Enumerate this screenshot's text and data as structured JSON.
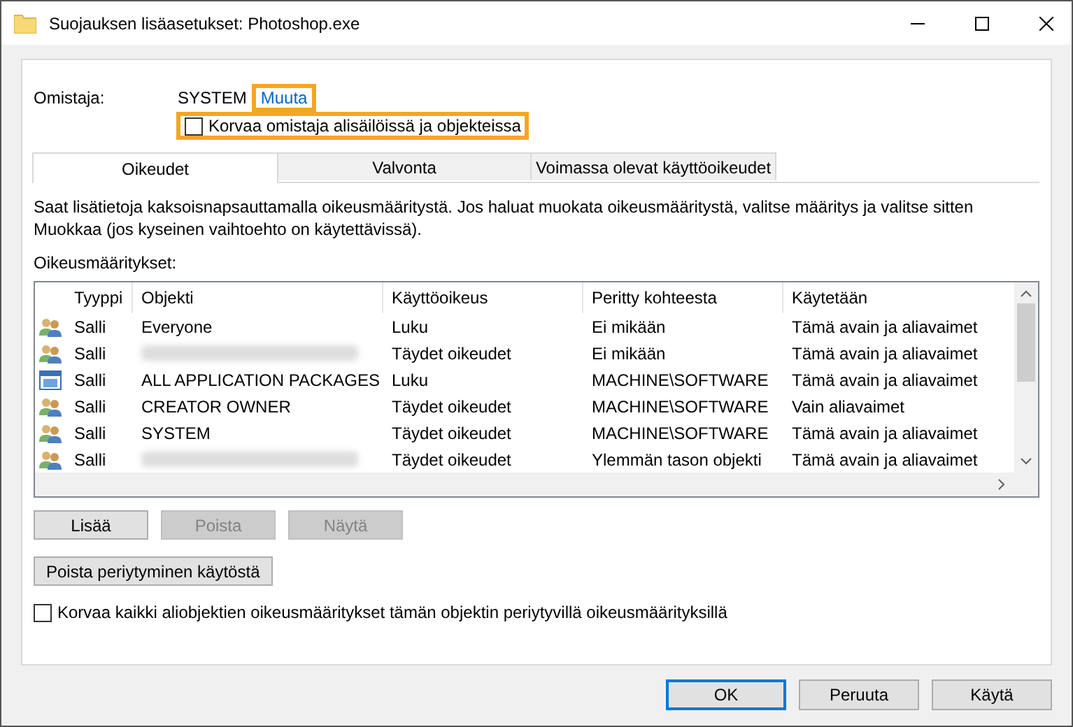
{
  "window": {
    "title": "Suojauksen lisäasetukset: Photoshop.exe"
  },
  "owner": {
    "label": "Omistaja:",
    "value": "SYSTEM",
    "change_link": {
      "text": "Muuta",
      "highlighted": true
    },
    "replace_checkbox": {
      "label": "Korvaa omistaja alisäilöissä ja objekteissa",
      "checked": false,
      "highlighted": true
    }
  },
  "tabs": [
    {
      "label": "Oikeudet",
      "selected": true
    },
    {
      "label": "Valvonta",
      "selected": false
    },
    {
      "label": "Voimassa olevat käyttöoikeudet",
      "selected": false
    }
  ],
  "info": "Saat lisätietoja kaksoisnapsauttamalla oikeusmääritystä. Jos haluat muokata oikeusmääritystä, valitse määritys ja valitse sitten Muokkaa (jos kyseinen vaihtoehto on käytettävissä).",
  "list_label": "Oikeusmääritykset:",
  "table": {
    "columns": [
      "Tyyppi",
      "Objekti",
      "Käyttöoikeus",
      "Peritty kohteesta",
      "Käytetään"
    ],
    "rows": [
      {
        "kind": "group",
        "type": "Salli",
        "object": "Everyone",
        "redacted": false,
        "access": "Luku",
        "inherited": "Ei mikään",
        "applies": "Tämä avain ja aliavaimet"
      },
      {
        "kind": "group",
        "type": "Salli",
        "redacted": true,
        "access": "Täydet oikeudet",
        "inherited": "Ei mikään",
        "applies": "Tämä avain ja aliavaimet"
      },
      {
        "kind": "package",
        "type": "Salli",
        "object": "ALL APPLICATION PACKAGES",
        "redacted": false,
        "access": "Luku",
        "inherited": "MACHINE\\SOFTWARE",
        "applies": "Tämä avain ja aliavaimet"
      },
      {
        "kind": "group",
        "type": "Salli",
        "object": "CREATOR OWNER",
        "redacted": false,
        "access": "Täydet oikeudet",
        "inherited": "MACHINE\\SOFTWARE",
        "applies": "Vain aliavaimet"
      },
      {
        "kind": "group",
        "type": "Salli",
        "object": "SYSTEM",
        "redacted": false,
        "access": "Täydet oikeudet",
        "inherited": "MACHINE\\SOFTWARE",
        "applies": "Tämä avain ja aliavaimet"
      },
      {
        "kind": "group",
        "type": "Salli",
        "redacted": true,
        "access": "Täydet oikeudet",
        "inherited": "Ylemmän tason objekti",
        "applies": "Tämä avain ja aliavaimet"
      }
    ]
  },
  "list_buttons": [
    {
      "label": "Lisää",
      "disabled": false
    },
    {
      "label": "Poista",
      "disabled": true
    },
    {
      "label": "Näytä",
      "disabled": true
    }
  ],
  "inheritance_button": {
    "label": "Poista periytyminen käytöstä"
  },
  "replace_children_checkbox": {
    "label": "Korvaa kaikki aliobjektien oikeusmääritykset tämän objektin periytyvillä oikeusmäärityksillä",
    "checked": false
  },
  "footer_buttons": [
    {
      "label": "OK",
      "default": true
    },
    {
      "label": "Peruuta",
      "default": false
    },
    {
      "label": "Käytä",
      "default": false
    }
  ]
}
